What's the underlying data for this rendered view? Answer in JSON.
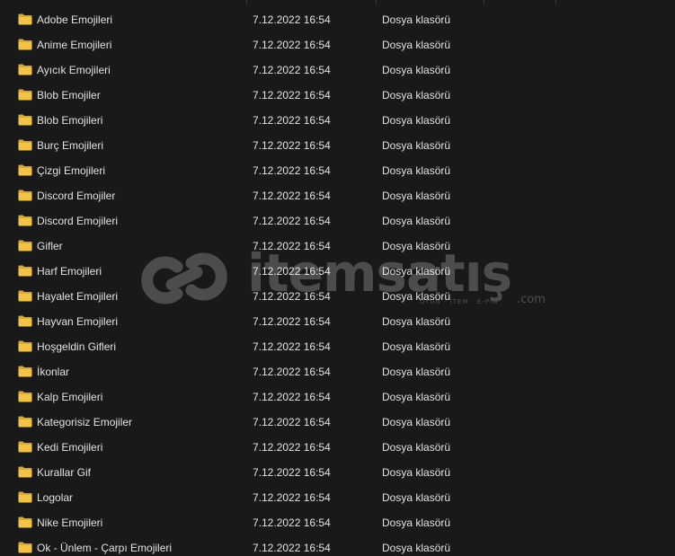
{
  "colors": {
    "background": "#191919",
    "text": "#e2e2e2",
    "folder_body": "#f2c344",
    "folder_back": "#d9a92f"
  },
  "icon": "folder-icon",
  "watermark": {
    "brand": "itemsatış",
    "tagline": "OYUN · İTEM · E-PIN",
    "suffix": ".com"
  },
  "files": [
    {
      "name": "Adobe Emojileri",
      "date": "7.12.2022 16:54",
      "type": "Dosya klasörü"
    },
    {
      "name": "Anime Emojileri",
      "date": "7.12.2022 16:54",
      "type": "Dosya klasörü"
    },
    {
      "name": "Ayıcık Emojileri",
      "date": "7.12.2022 16:54",
      "type": "Dosya klasörü"
    },
    {
      "name": "Blob Emojiler",
      "date": "7.12.2022 16:54",
      "type": "Dosya klasörü"
    },
    {
      "name": "Blob Emojileri",
      "date": "7.12.2022 16:54",
      "type": "Dosya klasörü"
    },
    {
      "name": "Burç Emojileri",
      "date": "7.12.2022 16:54",
      "type": "Dosya klasörü"
    },
    {
      "name": "Çizgi Emojileri",
      "date": "7.12.2022 16:54",
      "type": "Dosya klasörü"
    },
    {
      "name": "Discord Emojiler",
      "date": "7.12.2022 16:54",
      "type": "Dosya klasörü"
    },
    {
      "name": "Discord Emojileri",
      "date": "7.12.2022 16:54",
      "type": "Dosya klasörü"
    },
    {
      "name": "Gifler",
      "date": "7.12.2022 16:54",
      "type": "Dosya klasörü"
    },
    {
      "name": "Harf Emojileri",
      "date": "7.12.2022 16:54",
      "type": "Dosya klasörü"
    },
    {
      "name": "Hayalet Emojileri",
      "date": "7.12.2022 16:54",
      "type": "Dosya klasörü"
    },
    {
      "name": "Hayvan Emojileri",
      "date": "7.12.2022 16:54",
      "type": "Dosya klasörü"
    },
    {
      "name": "Hoşgeldin Gifleri",
      "date": "7.12.2022 16:54",
      "type": "Dosya klasörü"
    },
    {
      "name": "İkonlar",
      "date": "7.12.2022 16:54",
      "type": "Dosya klasörü"
    },
    {
      "name": "Kalp Emojileri",
      "date": "7.12.2022 16:54",
      "type": "Dosya klasörü"
    },
    {
      "name": "Kategorisiz Emojiler",
      "date": "7.12.2022 16:54",
      "type": "Dosya klasörü"
    },
    {
      "name": "Kedi Emojileri",
      "date": "7.12.2022 16:54",
      "type": "Dosya klasörü"
    },
    {
      "name": "Kurallar Gif",
      "date": "7.12.2022 16:54",
      "type": "Dosya klasörü"
    },
    {
      "name": "Logolar",
      "date": "7.12.2022 16:54",
      "type": "Dosya klasörü"
    },
    {
      "name": "Nike Emojileri",
      "date": "7.12.2022 16:54",
      "type": "Dosya klasörü"
    },
    {
      "name": "Ok - Ünlem - Çarpı Emojileri",
      "date": "7.12.2022 16:54",
      "type": "Dosya klasörü"
    }
  ]
}
